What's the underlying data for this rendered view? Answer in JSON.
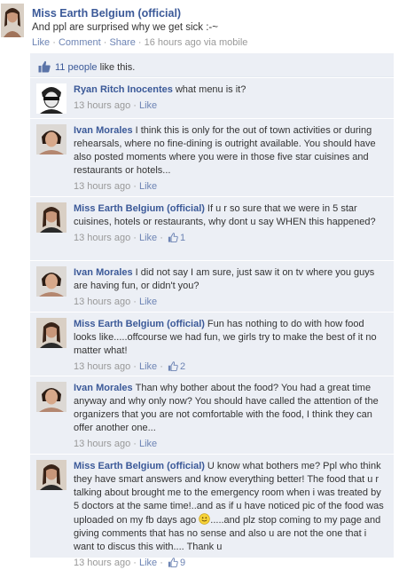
{
  "post": {
    "author": "Miss Earth Belgium (official)",
    "message": "And ppl are surprised why we get sick :-~",
    "like_label": "Like",
    "comment_label": "Comment",
    "share_label": "Share",
    "sep": "·",
    "time": "16 hours ago via mobile"
  },
  "likes": {
    "count_text": "11 people",
    "suffix": " like this."
  },
  "comments": [
    {
      "author": "Ryan Ritch Inocentes",
      "text": "what menu is it?",
      "time": "13 hours ago",
      "like_label": "Like",
      "likes": ""
    },
    {
      "author": "Ivan Morales",
      "text": "I think this is only for the out of town activities or during rehearsals, where no fine-dining is outright available. You should have also posted moments where you were in those five star cuisines and restaurants or hotels...",
      "time": "13 hours ago",
      "like_label": "Like",
      "likes": ""
    },
    {
      "author": "Miss Earth Belgium (official)",
      "text": "If u r so sure that we were in 5 star cuisines, hotels or restaurants, why dont u say WHEN this happened?",
      "time": "13 hours ago",
      "like_label": "Like",
      "likes": "1"
    },
    {
      "author": "Ivan Morales",
      "text": "I did not say I am sure, just saw it on tv where you guys are having fun, or didn't you?",
      "time": "13 hours ago",
      "like_label": "Like",
      "likes": ""
    },
    {
      "author": "Miss Earth Belgium (official)",
      "text": "Fun has nothing to do with how food looks like.....offcourse we had fun, we girls try to make the best of it no matter what!",
      "time": "13 hours ago",
      "like_label": "Like",
      "likes": "2"
    },
    {
      "author": "Ivan Morales",
      "text": "Than why bother about the food? You had a great time anyway and why only now? You should have called the attention of the organizers that you are not comfortable with the food, I think they can offer another one...",
      "time": "13 hours ago",
      "like_label": "Like",
      "likes": ""
    },
    {
      "author": "Miss Earth Belgium (official)",
      "text_before": "U know what bothers me? Ppl who think they have smart answers and know everything better! The food that u r talking about brought me to the emergency room when i was treated by 5 doctors at the same time!..and as if u have noticed pic of the food was uploaded on my fb days ago",
      "text_after": ".....and plz stop coming to my page and giving comments that has no sense and also u are not the one that i want to discus this with.... Thank u",
      "time": "13 hours ago",
      "like_label": "Like",
      "likes": "9"
    }
  ],
  "icons": {
    "thumb": "thumbs-up-icon",
    "smiley": "smiley-icon"
  },
  "colors": {
    "link": "#3b5998",
    "feedback_bg": "#eceff5"
  }
}
